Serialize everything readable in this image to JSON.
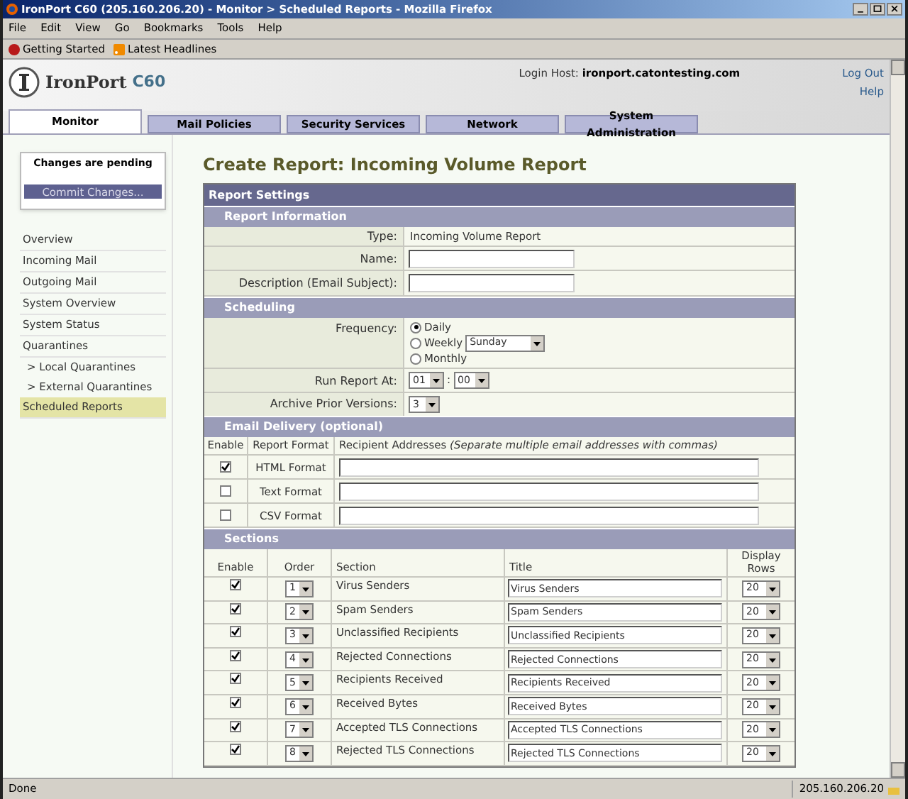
{
  "window": {
    "title": "IronPort C60 (205.160.206.20) - Monitor > Scheduled Reports - Mozilla Firefox"
  },
  "menu": [
    "File",
    "Edit",
    "View",
    "Go",
    "Bookmarks",
    "Tools",
    "Help"
  ],
  "bookmarks": [
    {
      "label": "Getting Started",
      "kind": "start"
    },
    {
      "label": "Latest Headlines",
      "kind": "feed"
    }
  ],
  "header": {
    "brand": "IronPort",
    "model": "C60",
    "login_label": "Login Host:",
    "login_host": "ironport.catontesting.com",
    "links": [
      "Log Out",
      "Help"
    ]
  },
  "tabs": [
    {
      "label": "Monitor",
      "selected": true
    },
    {
      "label": "Mail Policies",
      "selected": false
    },
    {
      "label": "Security Services",
      "selected": false
    },
    {
      "label": "Network",
      "selected": false
    },
    {
      "label": "System Administration",
      "selected": false
    }
  ],
  "pending": {
    "message": "Changes are pending",
    "button": "Commit Changes..."
  },
  "sidebar": {
    "items": [
      {
        "label": "Overview",
        "selected": false
      },
      {
        "label": "Incoming Mail",
        "selected": false
      },
      {
        "label": "Outgoing Mail",
        "selected": false
      },
      {
        "label": "System Overview",
        "selected": false
      },
      {
        "label": "System Status",
        "selected": false
      },
      {
        "label": "Quarantines",
        "selected": false,
        "children": [
          {
            "label": "> Local Quarantines",
            "selected": false
          },
          {
            "label": "> External Quarantines",
            "selected": false
          }
        ]
      },
      {
        "label": "Scheduled Reports",
        "selected": true
      }
    ]
  },
  "page_title": "Create Report: Incoming Volume Report",
  "report": {
    "title": "Report Settings",
    "information": {
      "title": "Report Information",
      "type_label": "Type:",
      "type_value": "Incoming Volume Report",
      "name_label": "Name:",
      "description_label": "Description (Email Subject):"
    },
    "scheduling": {
      "title": "Scheduling",
      "frequency_label": "Frequency:",
      "options": [
        {
          "label": "Daily",
          "selected": true
        },
        {
          "label": "Weekly",
          "selected": false,
          "day": "Sunday"
        },
        {
          "label": "Monthly",
          "selected": false
        }
      ],
      "run_label": "Run Report At:",
      "hour": "01",
      "separator": ":",
      "minute": "00",
      "archive_label": "Archive Prior Versions:",
      "archive": "3"
    },
    "email": {
      "title": "Email Delivery (optional)",
      "columns": [
        "Enable",
        "Report Format",
        "Recipient Addresses"
      ],
      "columns_note": "(Separate multiple email addresses with commas)",
      "rows": [
        {
          "format": "HTML Format",
          "checked": true
        },
        {
          "format": "Text Format",
          "checked": false
        },
        {
          "format": "CSV Format",
          "checked": false
        }
      ]
    },
    "sections": {
      "title": "Sections",
      "columns": [
        "Enable",
        "Order",
        "Section",
        "Title",
        "Display Rows"
      ],
      "rows": [
        {
          "checked": true,
          "order": "1",
          "section": "Virus Senders",
          "title": "Virus Senders",
          "rows": "20"
        },
        {
          "checked": true,
          "order": "2",
          "section": "Spam Senders",
          "title": "Spam Senders",
          "rows": "20"
        },
        {
          "checked": true,
          "order": "3",
          "section": "Unclassified Recipients",
          "title": "Unclassified Recipients",
          "rows": "20"
        },
        {
          "checked": true,
          "order": "4",
          "section": "Rejected Connections",
          "title": "Rejected Connections",
          "rows": "20"
        },
        {
          "checked": true,
          "order": "5",
          "section": "Recipients Received",
          "title": "Recipients Received",
          "rows": "20"
        },
        {
          "checked": true,
          "order": "6",
          "section": "Received Bytes",
          "title": "Received Bytes",
          "rows": "20"
        },
        {
          "checked": true,
          "order": "7",
          "section": "Accepted TLS Connections",
          "title": "Accepted TLS Connections",
          "rows": "20"
        },
        {
          "checked": true,
          "order": "8",
          "section": "Rejected TLS Connections",
          "title": "Rejected TLS Connections",
          "rows": "20"
        }
      ]
    }
  },
  "status_bar": {
    "text": "Done",
    "address": "205.160.206.20"
  }
}
